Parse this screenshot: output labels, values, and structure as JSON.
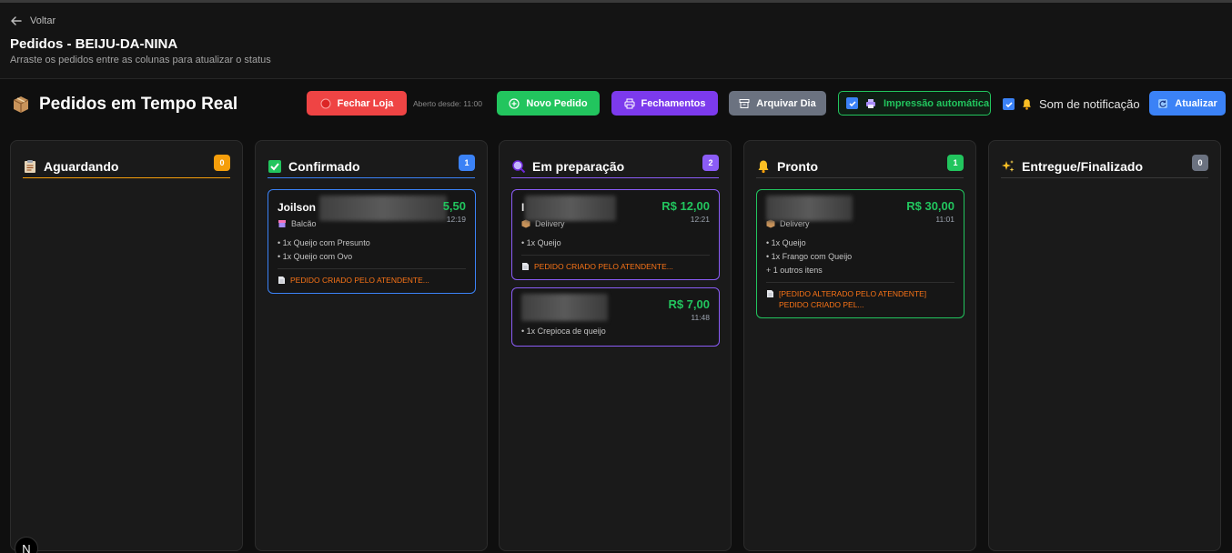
{
  "header": {
    "back_label": "Voltar",
    "title": "Pedidos - BEIJU-DA-NINA",
    "subtitle": "Arraste os pedidos entre as colunas para atualizar o status"
  },
  "toolbar": {
    "title": "Pedidos em Tempo Real",
    "close_store_label": "Fechar Loja",
    "open_since": "Aberto desde: 11:00",
    "new_order_label": "Novo Pedido",
    "closings_label": "Fechamentos",
    "archive_day_label": "Arquivar Dia",
    "auto_print_label": "Impressão automática",
    "auto_print_checked": true,
    "sound_label": "Som de notificação",
    "sound_checked": true,
    "refresh_label": "Atualizar"
  },
  "columns": [
    {
      "title": "Aguardando",
      "count": "0",
      "color": "#f59e0b",
      "icon": "clipboard-icon"
    },
    {
      "title": "Confirmado",
      "count": "1",
      "color": "#3b82f6",
      "icon": "check-icon"
    },
    {
      "title": "Em preparação",
      "count": "2",
      "color": "#8b5cf6",
      "icon": "magnifier-icon"
    },
    {
      "title": "Pronto",
      "count": "1",
      "color": "#22c55e",
      "icon": "bell-icon"
    },
    {
      "title": "Entregue/Finalizado",
      "count": "0",
      "color": "#6b7280",
      "icon": "sparkles-icon"
    }
  ],
  "orders": {
    "confirmado": [
      {
        "customer": "Joilson",
        "price": "5,50",
        "time": "12:19",
        "type": "Balcão",
        "items": [
          "• 1x Queijo com Presunto",
          "• 1x Queijo com Ovo"
        ],
        "note": "PEDIDO CRIADO PELO ATENDENTE..."
      }
    ],
    "em_preparacao": [
      {
        "customer": "I",
        "price": "R$ 12,00",
        "time": "12:21",
        "type": "Delivery",
        "items": [
          "• 1x Queijo"
        ],
        "note": "PEDIDO CRIADO PELO ATENDENTE..."
      },
      {
        "customer": "",
        "price": "R$ 7,00",
        "time": "11:48",
        "type": "",
        "items": [
          "• 1x Crepioca de queijo"
        ],
        "note": ""
      }
    ],
    "pronto": [
      {
        "customer": "",
        "price": "R$ 30,00",
        "time": "11:01",
        "type": "Delivery",
        "items": [
          "• 1x Queijo",
          "• 1x Frango com Queijo",
          "+ 1 outros itens"
        ],
        "note": "[PEDIDO ALTERADO PELO ATENDENTE] PEDIDO CRIADO PEL..."
      }
    ]
  },
  "footer": {
    "badge": "N"
  }
}
